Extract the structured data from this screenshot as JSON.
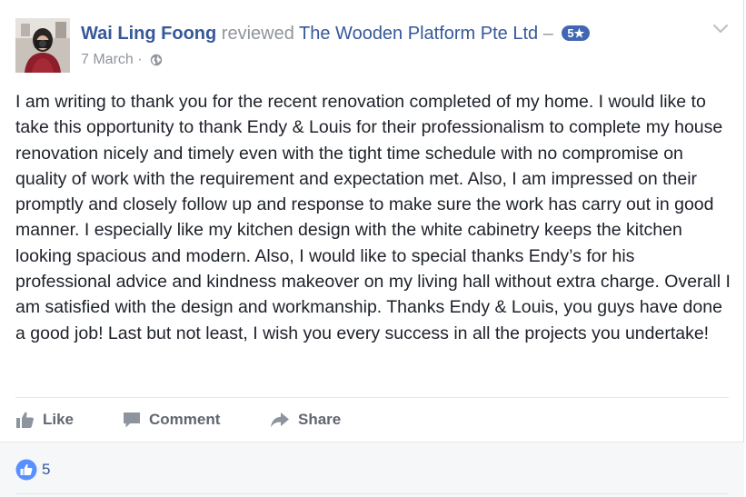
{
  "review": {
    "author": "Wai Ling Foong",
    "verb": "reviewed",
    "page": "The Wooden Platform Pte Ltd",
    "dash": "–",
    "rating": "5★",
    "date": "7 March",
    "separator": "·",
    "privacy_icon": "globe-icon",
    "options_icon": "chevron-down-icon",
    "text": "I am writing to thank you for the recent renovation completed of my home. I would like to take this opportunity to thank Endy & Louis for their professionalism to complete my house renovation nicely and timely even with the tight time schedule with no compromise on quality of work with the requirement and expectation met. Also, I am impressed on their promptly and closely follow up and response to make sure the work has carry out in good manner. I especially like my kitchen design with the white cabinetry keeps the kitchen looking spacious and modern. Also, I would like to special thanks Endy’s for his professional advice and kindness makeover on my living hall without extra charge. Overall I am satisfied with the design and workmanship. Thanks Endy & Louis, you guys have done a good job! Last but not least, I wish you every success in all the projects you undertake!"
  },
  "actions": {
    "like": "Like",
    "comment": "Comment",
    "share": "Share"
  },
  "reactions": {
    "count": "5",
    "icon": "thumbs-up-icon"
  },
  "colors": {
    "link": "#365899",
    "muted": "#90949c",
    "accent": "#4267b2",
    "action_text": "#606770",
    "footer_bg": "#f6f7f9"
  }
}
